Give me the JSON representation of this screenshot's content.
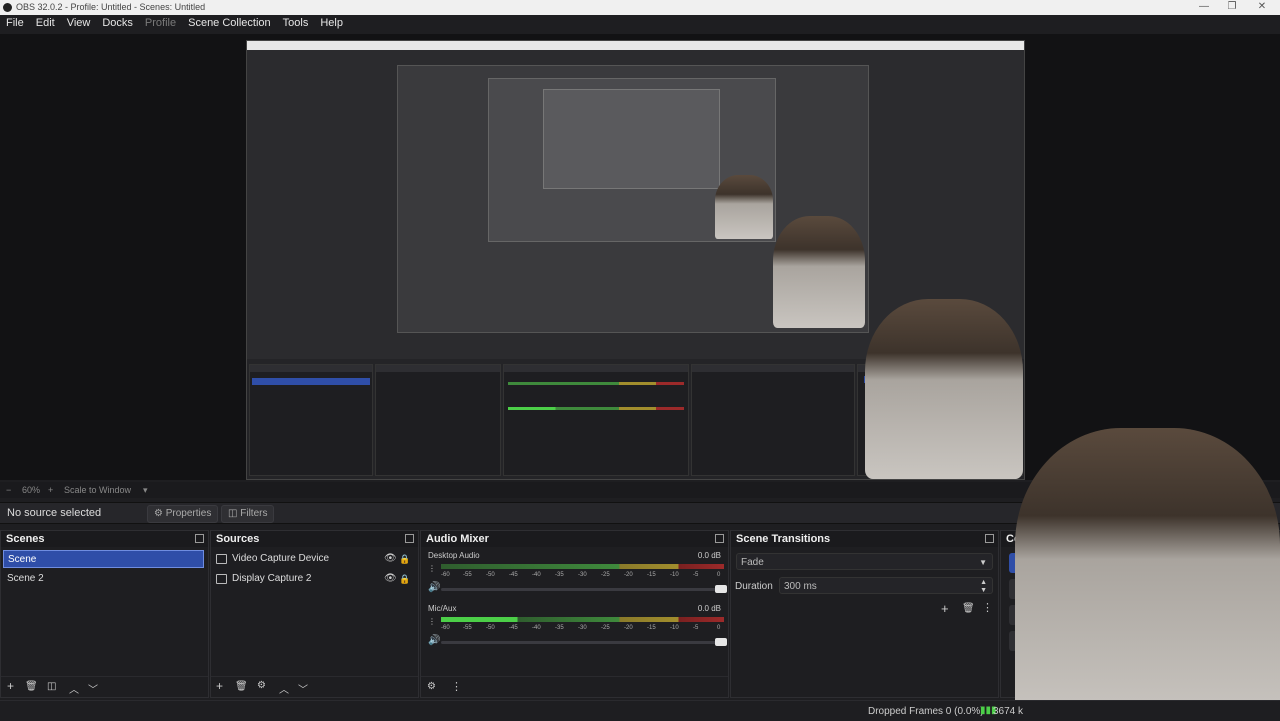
{
  "window": {
    "title": "OBS 32.0.2 - Profile: Untitled - Scenes: Untitled"
  },
  "menu": [
    "File",
    "Edit",
    "View",
    "Docks",
    "Profile",
    "Scene Collection",
    "Tools",
    "Help"
  ],
  "zoom": {
    "percent": "60%",
    "scale_label": "Scale to Window"
  },
  "source_bar": {
    "label": "No source selected",
    "properties": "Properties",
    "filters": "Filters"
  },
  "scenes": {
    "title": "Scenes",
    "items": [
      "Scene",
      "Scene 2"
    ],
    "selected_index": 0
  },
  "sources": {
    "title": "Sources",
    "items": [
      "Video Capture Device",
      "Display Capture 2"
    ]
  },
  "audio_mixer": {
    "title": "Audio Mixer",
    "channels": [
      {
        "name": "Desktop Audio",
        "db": "0.0 dB"
      },
      {
        "name": "Mic/Aux",
        "db": "0.0 dB"
      }
    ],
    "ticks": [
      "-60",
      "-55",
      "-50",
      "-45",
      "-40",
      "-35",
      "-30",
      "-25",
      "-20",
      "-15",
      "-10",
      "-5",
      "0"
    ]
  },
  "scene_transitions": {
    "title": "Scene Transitions",
    "transition": "Fade",
    "duration_label": "Duration",
    "duration_value": "300 ms"
  },
  "controls": {
    "title": "Controls"
  },
  "status": {
    "dropped_frames": "Dropped Frames 0 (0.0%)",
    "bitrate": "3674 k"
  },
  "colors": {
    "accent": "#2f4ea8",
    "background": "#1e1e21"
  }
}
